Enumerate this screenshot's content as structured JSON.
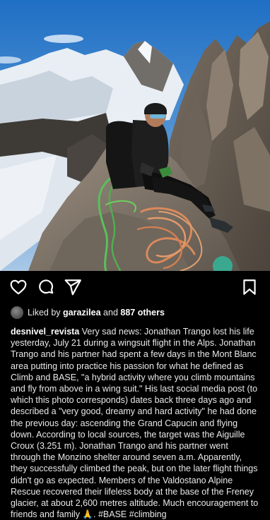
{
  "post": {
    "likes": {
      "prefix": "Liked by",
      "user": "garazilea",
      "and": "and",
      "count": "887 others"
    },
    "caption": {
      "username": "desnivel_revista",
      "text": "Very sad news: Jonathan Trango lost his life yesterday, July 21 during a wingsuit flight in the Alps. Jonathan Trango and his partner had spent a few days in the Mont Blanc area putting into practice his passion for what he defined as Climb and BASE, \"a hybrid activity where you climb mountains and fly from above in a wing suit.\" His last social media post (to which this photo corresponds) dates back three days ago and described a \"very good, dreamy and hard activity\" he had done the previous day: ascending the Grand Capucin and flying down. According to local sources, the target was the Aiguille Croux (3.251 m). Jonathan Trango and his partner went through the Monzino shelter around seven a.m. Apparently, they successfully climbed the peak, but on the later flight things didn't go as expected. Members of the Valdostano Alpine Rescue recovered their lifeless body at the base of the Freney glacier, at about 2,600 metres altitude. Much encouragement to friends and family 🙏.",
      "hashtags": "#BASE #climbing"
    }
  },
  "icons": {
    "like": "heart-icon",
    "comment": "comment-icon",
    "share": "send-icon",
    "save": "bookmark-icon"
  }
}
